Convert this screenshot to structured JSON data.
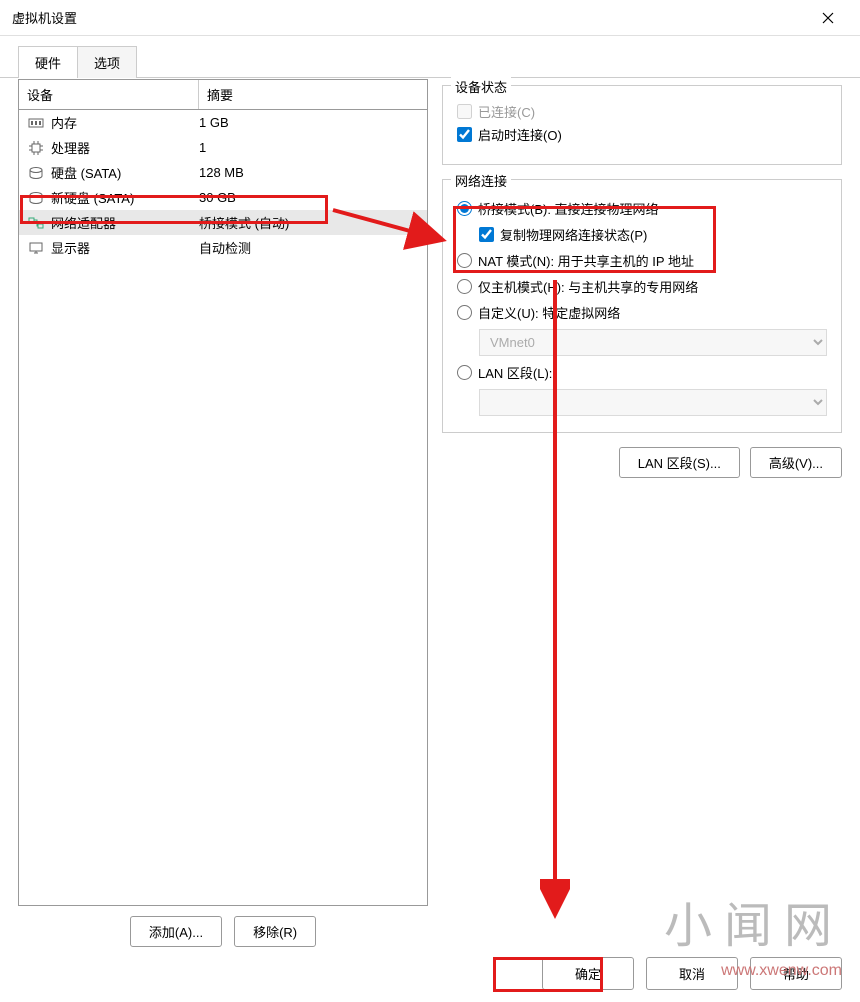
{
  "title": "虚拟机设置",
  "tabs": {
    "hardware": "硬件",
    "options": "选项"
  },
  "deviceTable": {
    "colDevice": "设备",
    "colSummary": "摘要",
    "rows": [
      {
        "name": "内存",
        "summary": "1 GB",
        "icon": "memory"
      },
      {
        "name": "处理器",
        "summary": "1",
        "icon": "cpu"
      },
      {
        "name": "硬盘 (SATA)",
        "summary": "128 MB",
        "icon": "disk"
      },
      {
        "name": "新硬盘 (SATA)",
        "summary": "30 GB",
        "icon": "disk"
      },
      {
        "name": "网络适配器",
        "summary": "桥接模式 (自动)",
        "icon": "network"
      },
      {
        "name": "显示器",
        "summary": "自动检测",
        "icon": "display"
      }
    ]
  },
  "deviceStatus": {
    "title": "设备状态",
    "connected": "已连接(C)",
    "connectOnStart": "启动时连接(O)"
  },
  "networkConn": {
    "title": "网络连接",
    "bridged": "桥接模式(B): 直接连接物理网络",
    "replicate": "复制物理网络连接状态(P)",
    "nat": "NAT 模式(N): 用于共享主机的 IP 地址",
    "hostOnly": "仅主机模式(H): 与主机共享的专用网络",
    "custom": "自定义(U): 特定虚拟网络",
    "customOption": "VMnet0",
    "lanSegment": "LAN 区段(L):",
    "lanOption": ""
  },
  "rightButtons": {
    "lanSeg": "LAN 区段(S)...",
    "advanced": "高级(V)..."
  },
  "leftButtons": {
    "add": "添加(A)...",
    "remove": "移除(R)"
  },
  "footer": {
    "ok": "确定",
    "cancel": "取消",
    "help": "帮助"
  },
  "watermark": {
    "main": "小闻网",
    "sub": "www.xwenw.com"
  }
}
